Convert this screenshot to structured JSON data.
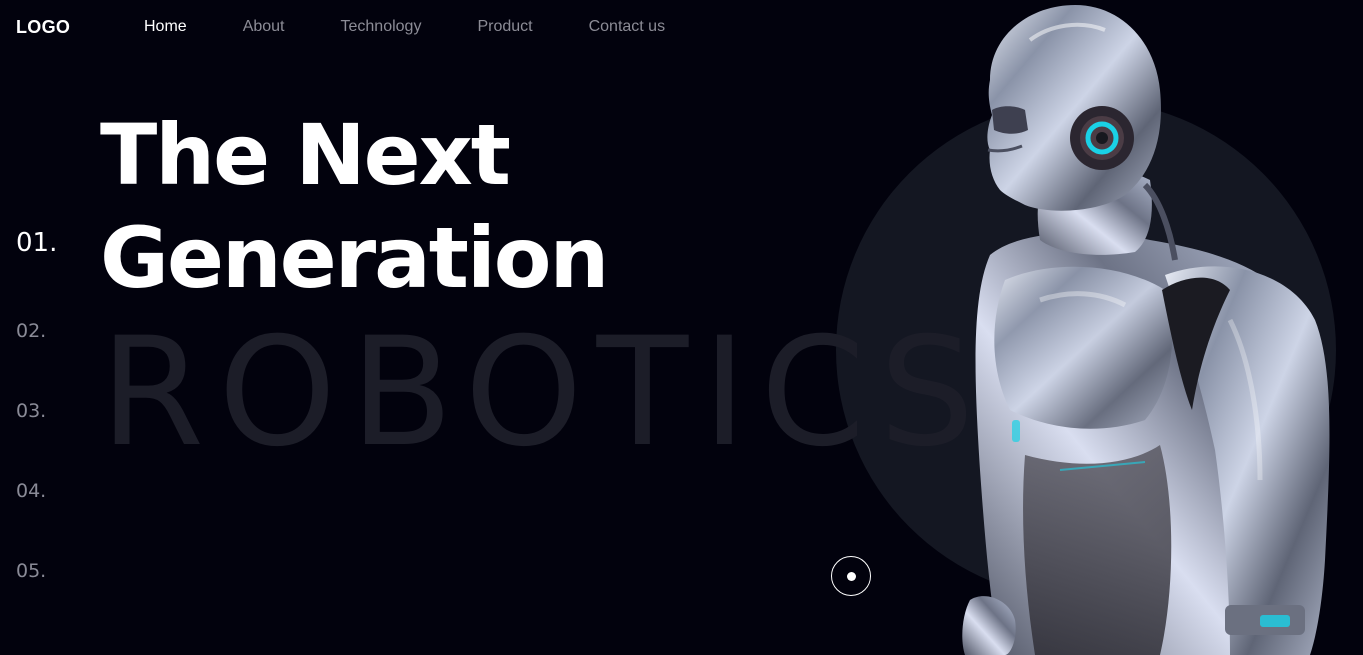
{
  "brand": {
    "logo_text": "LOGO"
  },
  "nav": {
    "items": [
      {
        "label": "Home",
        "active": true
      },
      {
        "label": "About",
        "active": false
      },
      {
        "label": "Technology",
        "active": false
      },
      {
        "label": "Product",
        "active": false
      },
      {
        "label": "Contact us",
        "active": false
      }
    ]
  },
  "hero": {
    "headline_line1": "The Next",
    "headline_line2": "Generation",
    "watermark": "ROBOTICS"
  },
  "slides": {
    "active_index": 0,
    "items": [
      "01.",
      "02.",
      "03.",
      "04.",
      "05."
    ]
  },
  "scroll_indicator": {
    "icon": "scroll-dot-icon"
  },
  "image": {
    "subject": "robot-illustration"
  },
  "colors": {
    "background": "#02020d",
    "circle": "#141722",
    "watermark": "#1c1d28",
    "nav_inactive": "#8c8c96",
    "accent_cyan": "#1ad1e6"
  }
}
